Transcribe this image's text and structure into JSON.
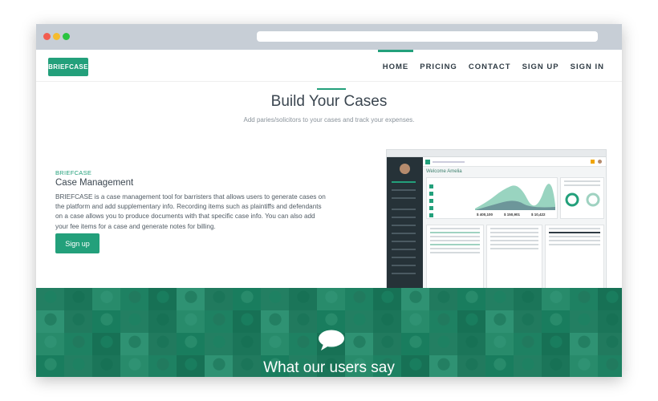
{
  "nav": {
    "logo": "BRIEFCASE",
    "items": [
      {
        "label": "HOME",
        "active": true
      },
      {
        "label": "PRICING",
        "active": false
      },
      {
        "label": "CONTACT",
        "active": false
      },
      {
        "label": "SIGN UP",
        "active": false
      },
      {
        "label": "SIGN IN",
        "active": false
      }
    ]
  },
  "hero": {
    "title": "Build Your Cases",
    "subtitle": "Add paries/solicitors to your cases and track your expenses."
  },
  "feature": {
    "kicker": "BRIEFCASE",
    "title": "Case Management",
    "description": "BRIEFCASE is a case management tool for barristers that allows users to generate cases on the platform and add supplementary info. Recording items such as plaintiffs and defendants on a case allows you to produce documents with that specific case info. You can also add your fee items for a case and generate notes for billing.",
    "cta": "Sign up"
  },
  "preview": {
    "welcome": "Welcome Amelia",
    "stats": [
      "$ 400,100",
      "$ 150,901",
      "$ 10,422"
    ]
  },
  "testimonials": {
    "title": "What our users say"
  },
  "colors": {
    "brand": "#23a07b",
    "text": "#3b4650"
  }
}
